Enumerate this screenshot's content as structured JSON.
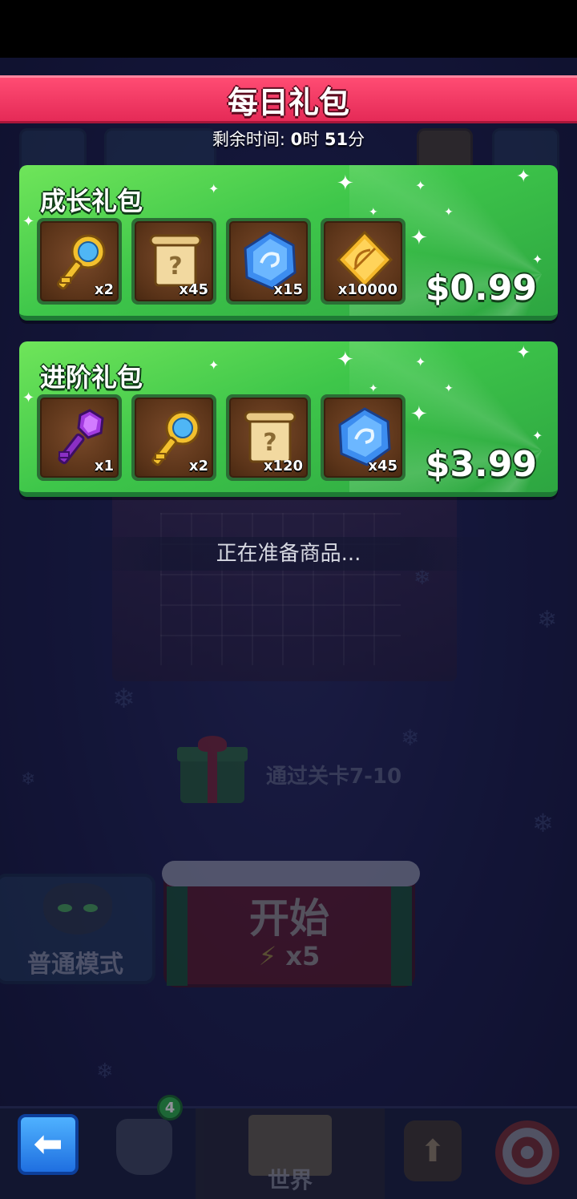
{
  "modal": {
    "title": "每日礼包",
    "timer": {
      "label": "剩余时间:",
      "hours": "0",
      "hours_unit": "时",
      "minutes": "51",
      "minutes_unit": "分"
    }
  },
  "packs": [
    {
      "title": "成长礼包",
      "price": "$0.99",
      "items": [
        {
          "icon": "gold-key-icon",
          "count": "x2"
        },
        {
          "icon": "scroll-icon",
          "count": "x45"
        },
        {
          "icon": "blue-gem-icon",
          "count": "x15"
        },
        {
          "icon": "gold-bow-token-icon",
          "count": "x10000"
        }
      ]
    },
    {
      "title": "进阶礼包",
      "price": "$3.99",
      "items": [
        {
          "icon": "purple-key-icon",
          "count": "x1"
        },
        {
          "icon": "gold-key-icon",
          "count": "x2"
        },
        {
          "icon": "scroll-icon",
          "count": "x120"
        },
        {
          "icon": "blue-gem-icon",
          "count": "x45"
        }
      ]
    }
  ],
  "status": {
    "preparing": "正在准备商品..."
  },
  "background": {
    "unlock_text": "通过关卡7-10",
    "mode_button_label": "普通模式",
    "start_button_label": "开始",
    "start_cost": "x5"
  },
  "bottom_nav": {
    "equipment_badge": "4",
    "world_label": "世界"
  },
  "colors": {
    "title_bar": "#e52a57",
    "pack_green": "#3ec64a",
    "back_button": "#1f6fe0"
  }
}
